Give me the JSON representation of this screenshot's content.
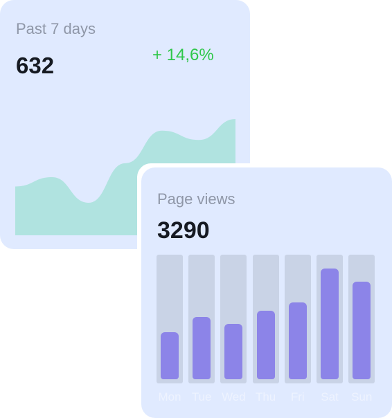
{
  "stats_card": {
    "period_label": "Past 7 days",
    "total": "632",
    "change": "+ 14,6%",
    "colors": {
      "area": "#b0e3e0",
      "change": "#2ec74a"
    }
  },
  "views_card": {
    "title": "Page views",
    "value": "3290",
    "colors": {
      "track": "#c9d3e6",
      "bar": "#8c84e8"
    }
  },
  "chart_data": [
    {
      "type": "area",
      "title": "",
      "x": [
        0,
        1,
        2,
        3,
        4,
        5,
        6
      ],
      "values": [
        0.42,
        0.5,
        0.28,
        0.62,
        0.9,
        0.82,
        1.0
      ],
      "grid": false
    },
    {
      "type": "bar",
      "categories": [
        "Mon",
        "Tue",
        "Wed",
        "Thu",
        "Fri",
        "Sat",
        "Sun"
      ],
      "values": [
        0.39,
        0.52,
        0.46,
        0.57,
        0.64,
        0.92,
        0.81
      ],
      "ylim": [
        0,
        1
      ],
      "grid": false
    }
  ]
}
